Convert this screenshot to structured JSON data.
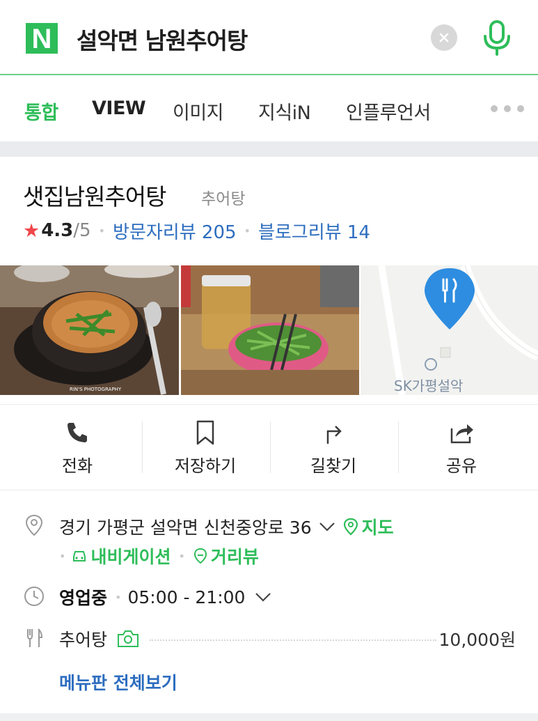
{
  "search": {
    "logo_letter": "N",
    "query": "설악면 남원추어탕",
    "brand_color": "#2ebd59"
  },
  "tabs": [
    {
      "label": "통합",
      "active": true
    },
    {
      "label": "VIEW",
      "active": false
    },
    {
      "label": "이미지",
      "active": false
    },
    {
      "label": "지식iN",
      "active": false
    },
    {
      "label": "인플루언서",
      "active": false
    }
  ],
  "place": {
    "name": "샛집남원추어탕",
    "category": "추어탕",
    "rating": "4.3",
    "rating_max": "/5",
    "visitor_reviews": "방문자리뷰 205",
    "blog_reviews": "블로그리뷰 14",
    "photo_captions": [
      "RIN'S PHOTOGRAPHY"
    ],
    "map_label": "SK가평설악"
  },
  "actions": [
    {
      "label": "전화",
      "icon": "phone-icon"
    },
    {
      "label": "저장하기",
      "icon": "bookmark-icon"
    },
    {
      "label": "길찾기",
      "icon": "directions-icon"
    },
    {
      "label": "공유",
      "icon": "share-icon"
    }
  ],
  "info": {
    "address": "경기 가평군 설악면 신천중앙로 36",
    "map_link": "지도",
    "navigation_link": "내비게이션",
    "streetview_link": "거리뷰",
    "status": "영업중",
    "hours": "05:00 - 21:00",
    "menu_item": "추어탕",
    "menu_price": "10,000원",
    "menu_all": "메뉴판 전체보기"
  }
}
